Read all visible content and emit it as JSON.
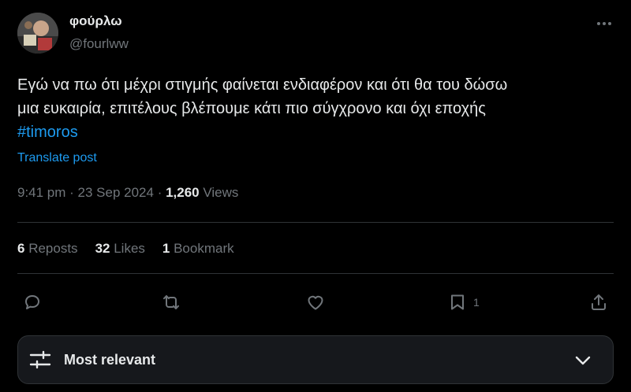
{
  "author": {
    "display_name": "φούρλω",
    "handle": "@fourlww"
  },
  "post": {
    "text_lines": [
      "Εγώ να πω ότι μέχρι στιγμής φαίνεται ενδιαφέρον και ότι θα του δώσω",
      "μια ευκαιρία, επιτέλους βλέπουμε κάτι πιο σύγχρονο και όχι εποχής"
    ],
    "hashtag": "#timoros",
    "translate_label": "Translate post"
  },
  "meta": {
    "time": "9:41 pm",
    "separator": " · ",
    "date": "23 Sep 2024",
    "views_count": "1,260",
    "views_label": " Views"
  },
  "stats": {
    "reposts_count": "6",
    "reposts_label": " Reposts",
    "likes_count": "32",
    "likes_label": " Likes",
    "bookmarks_count": "1",
    "bookmarks_label": " Bookmark"
  },
  "actions": {
    "reply_icon": "reply-icon",
    "repost_icon": "repost-icon",
    "like_icon": "heart-icon",
    "bookmark_icon": "bookmark-icon",
    "bookmark_count": "1",
    "share_icon": "share-icon"
  },
  "sort": {
    "label": "Most relevant",
    "icon": "sliders-icon",
    "chevron": "chevron-down-icon"
  },
  "colors": {
    "background": "#000000",
    "text_primary": "#e7e9ea",
    "text_secondary": "#71767b",
    "accent": "#1d9bf0",
    "divider": "#2f3336"
  }
}
